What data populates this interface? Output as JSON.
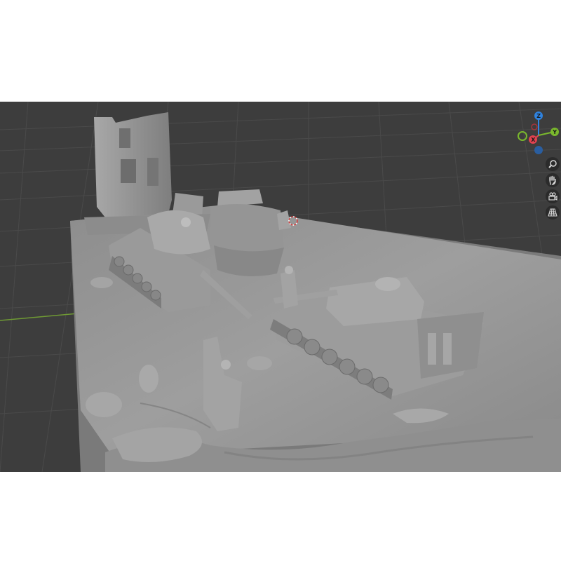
{
  "viewport": {
    "background": "#3d3d3d",
    "grid_color": "#484848",
    "x_axis_color": "#6f9a34",
    "model_color": "#9c9c9c",
    "model_shadow": "#6e6e6e",
    "model_highlight": "#b8b8b8"
  },
  "gizmo": {
    "z_label": "Z",
    "x_label": "X",
    "y_label": "Y",
    "z_color": "#2f83e0",
    "x_color": "#e2424f",
    "y_color": "#7ab82d"
  },
  "navigation": {
    "zoom_icon": "magnifier-icon",
    "pan_icon": "hand-icon",
    "camera_icon": "camera-icon",
    "ortho_icon": "grid-icon"
  }
}
